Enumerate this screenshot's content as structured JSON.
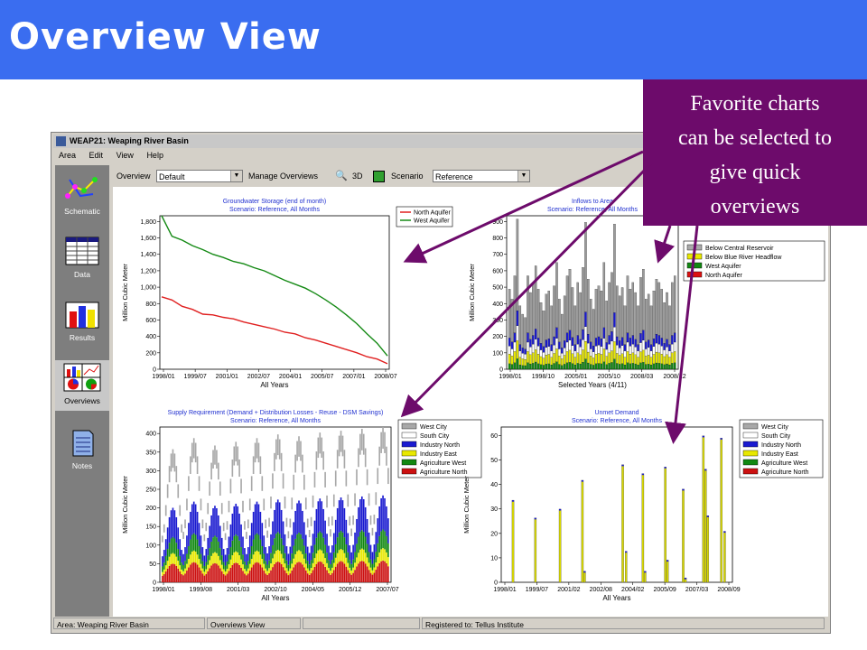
{
  "slide": {
    "title": "Overview View"
  },
  "callout": {
    "lines": [
      "Favorite charts",
      "can be selected to",
      "give quick",
      "overviews"
    ]
  },
  "window": {
    "title": "WEAP21: Weaping River Basin",
    "menu": [
      "Area",
      "Edit",
      "View",
      "Help"
    ]
  },
  "sidebar": [
    {
      "label": "Schematic",
      "icon": "schematic-icon"
    },
    {
      "label": "Data",
      "icon": "data-icon"
    },
    {
      "label": "Results",
      "icon": "results-icon"
    },
    {
      "label": "Overviews",
      "icon": "overviews-icon"
    },
    {
      "label": "Notes",
      "icon": "notes-icon"
    }
  ],
  "toolbar": {
    "overview_label": "Overview",
    "overview_value": "Default",
    "manage_label": "Manage Overviews",
    "threed_label": "3D",
    "scenario_label": "Scenario",
    "scenario_value": "Reference"
  },
  "status": {
    "area": "Area: Weaping River Basin",
    "view": "Overviews View",
    "registered": "Registered to: Tellus Institute"
  },
  "chart_data": [
    {
      "type": "line",
      "title": "Groundwater Storage (end of month)",
      "subtitle": "Scenario: Reference,  All Months",
      "ylabel": "Million Cubic Meter",
      "xlabel": "All Years",
      "x_ticks": [
        "1998/01",
        "1999/07",
        "2001/01",
        "2002/07",
        "2004/01",
        "2005/07",
        "2007/01",
        "2008/07"
      ],
      "y_ticks": [
        0,
        200,
        400,
        600,
        800,
        "1,000",
        "1,200",
        "1,400",
        "1,600",
        "1,800"
      ],
      "ylim": [
        0,
        1950
      ],
      "legend": "top-right",
      "series": [
        {
          "name": "North Aquifer",
          "color": "#e02020",
          "values": [
            920,
            880,
            800,
            760,
            700,
            690,
            660,
            640,
            600,
            570,
            540,
            510,
            470,
            450,
            400,
            370,
            330,
            290,
            250,
            210,
            160,
            130,
            70
          ]
        },
        {
          "name": "West Aquifer",
          "color": "#158a15",
          "values": [
            1950,
            1690,
            1640,
            1570,
            1520,
            1460,
            1420,
            1370,
            1340,
            1290,
            1250,
            1190,
            1130,
            1080,
            1030,
            960,
            880,
            790,
            690,
            580,
            450,
            330,
            170
          ]
        }
      ]
    },
    {
      "type": "bar",
      "title": "Inflows to Area",
      "subtitle": "Scenario: Reference,  All Months",
      "ylabel": "Million Cubic Meter",
      "xlabel": "Selected Years (4/11)",
      "x_ticks": [
        "1998/01",
        "1998/10",
        "2005/01",
        "2005/10",
        "2008/03",
        "2008/12"
      ],
      "y_ticks": [
        0,
        100,
        200,
        300,
        400,
        500,
        600,
        700,
        800,
        900
      ],
      "ylim": [
        0,
        920
      ],
      "legend_visible": [
        "Below Central Reservoir",
        "Below Blue River Headflow",
        "West Aquifer",
        "North Aquifer"
      ],
      "legend_colors": [
        "#aaaaaa",
        "#e8e800",
        "#118811",
        "#dd1111"
      ],
      "values": [
        480,
        420,
        560,
        900,
        380,
        330,
        310,
        560,
        460,
        520,
        620,
        480,
        400,
        350,
        450,
        470,
        380,
        500,
        640,
        420,
        330,
        440,
        560,
        600,
        490,
        380,
        520,
        460,
        610,
        880,
        540,
        420,
        360,
        480,
        500,
        470,
        640,
        410,
        520,
        580,
        870,
        500,
        440,
        490,
        380,
        560,
        480,
        520,
        460,
        380,
        550,
        600,
        420,
        450,
        380,
        470,
        540,
        520,
        480,
        400,
        460,
        380,
        520,
        560
      ]
    },
    {
      "type": "bar",
      "title": "Supply Requirement (Demand + Distribution Losses - Reuse - DSM Savings)",
      "subtitle": "Scenario: Reference,  All Months",
      "ylabel": "Million Cubic Meter",
      "xlabel": "All Years",
      "x_ticks": [
        "1998/01",
        "1999/08",
        "2001/03",
        "2002/10",
        "2004/05",
        "2005/12",
        "2007/07"
      ],
      "y_ticks": [
        0,
        50,
        100,
        150,
        200,
        250,
        300,
        350,
        400
      ],
      "ylim": [
        0,
        420
      ],
      "legend": "top-right",
      "legend_items": [
        {
          "name": "West City",
          "color": "#a8a8a8"
        },
        {
          "name": "South City",
          "color": "#ffffff"
        },
        {
          "name": "Industry North",
          "color": "#1a1ad0"
        },
        {
          "name": "Industry East",
          "color": "#e8e800"
        },
        {
          "name": "Agriculture West",
          "color": "#118811"
        },
        {
          "name": "Agriculture North",
          "color": "#cc1111"
        }
      ],
      "peaks": [
        360,
        390,
        370,
        380,
        390,
        400,
        395,
        405,
        410,
        415,
        420
      ]
    },
    {
      "type": "bar",
      "title": "Unmet Demand",
      "subtitle": "Scenario: Reference,  All Months",
      "ylabel": "Million Cubic Meter",
      "xlabel": "All Years",
      "x_ticks": [
        "1998/01",
        "1999/07",
        "2001/02",
        "2002/08",
        "2004/02",
        "2005/09",
        "2007/03",
        "2008/09"
      ],
      "y_ticks": [
        0,
        10,
        20,
        30,
        40,
        50,
        60
      ],
      "ylim": [
        0,
        70
      ],
      "legend": "top-right",
      "legend_items": [
        {
          "name": "West City",
          "color": "#a8a8a8"
        },
        {
          "name": "South City",
          "color": "#ffffff"
        },
        {
          "name": "Industry North",
          "color": "#1a1ad0"
        },
        {
          "name": "Industry East",
          "color": "#e8e800"
        },
        {
          "name": "Agriculture West",
          "color": "#118811"
        },
        {
          "name": "Agriculture North",
          "color": "#cc1111"
        }
      ],
      "bars": [
        {
          "x": 0.04,
          "v": 37
        },
        {
          "x": 0.14,
          "v": 29
        },
        {
          "x": 0.25,
          "v": 33
        },
        {
          "x": 0.35,
          "v": 46
        },
        {
          "x": 0.36,
          "v": 5
        },
        {
          "x": 0.53,
          "v": 53
        },
        {
          "x": 0.545,
          "v": 14
        },
        {
          "x": 0.62,
          "v": 49
        },
        {
          "x": 0.63,
          "v": 5
        },
        {
          "x": 0.72,
          "v": 52
        },
        {
          "x": 0.73,
          "v": 10
        },
        {
          "x": 0.8,
          "v": 42
        },
        {
          "x": 0.81,
          "v": 2
        },
        {
          "x": 0.89,
          "v": 66
        },
        {
          "x": 0.9,
          "v": 51
        },
        {
          "x": 0.91,
          "v": 30
        },
        {
          "x": 0.97,
          "v": 65
        },
        {
          "x": 0.985,
          "v": 23
        }
      ]
    }
  ]
}
